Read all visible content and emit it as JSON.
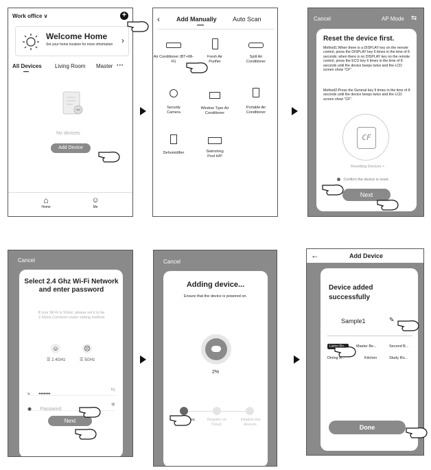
{
  "s1": {
    "home_name": "Work office",
    "welcome_title": "Welcome Home",
    "welcome_sub": "Set your home location for more information",
    "tabs": [
      "All Devices",
      "Living Room",
      "Master"
    ],
    "empty_text": "No devices",
    "add_btn": "Add Device",
    "nav": [
      "Home",
      "Me"
    ]
  },
  "s2": {
    "tab_manual": "Add Manually",
    "tab_scan": "Auto Scan",
    "items": [
      "Air Conditioner (BT+Wi-Fi)",
      "Fresh Air Purifier",
      "Split Air Conditioner",
      "Security Camera",
      "Window Type Air Conditioner",
      "Portable Air Conditioner",
      "Dehumidifier",
      "Swimming Pool H/P"
    ]
  },
  "s3": {
    "cancel": "Cancel",
    "mode": "AP Mode",
    "title": "Reset the device first.",
    "method1": "Method1:When there is a DISPLAY key on the remote control, press the DISPLAY key 6 times in the time of 8 seconds; when there is no DISPLAY key on the remote control, press the ECO key 6 times in the time of 8 seconds until the device beeps twice and the LCD screen show \"CF\".",
    "method2": "Method2:Press the General key 9 times in the time of 8 seconds until the device beeps twice and the LCD screen show \"CF\".",
    "display": "CF",
    "resetting": "Resetting Devices >",
    "confirm": "Confirm the device is reset.",
    "next": "Next"
  },
  "s4": {
    "cancel": "Cancel",
    "title": "Select 2.4 Ghz Wi-Fi Network and enter password",
    "note": "If your Wi-Fi is 5GHz, please set it to be 2.4GHz.Common router setting method",
    "band1": "2.4GHz",
    "band2": "5GHz",
    "wifi_value": "•••••••",
    "password_placeholder": "Password",
    "next": "Next"
  },
  "s5": {
    "cancel": "Cancel",
    "title": "Adding device...",
    "sub": "Ensure that the device is powered on.",
    "percent": "2%",
    "steps": [
      "Scan devices.",
      "Register on Cloud.",
      "Initialize the devices."
    ]
  },
  "s6": {
    "title": "Add Device",
    "heading": "Device added successfully",
    "device_name": "Sample1",
    "rooms": [
      "Living Ro...",
      "Master Be...",
      "Second B...",
      "Dining R...",
      "Kitchen",
      "Study Ro..."
    ],
    "done": "Done"
  }
}
